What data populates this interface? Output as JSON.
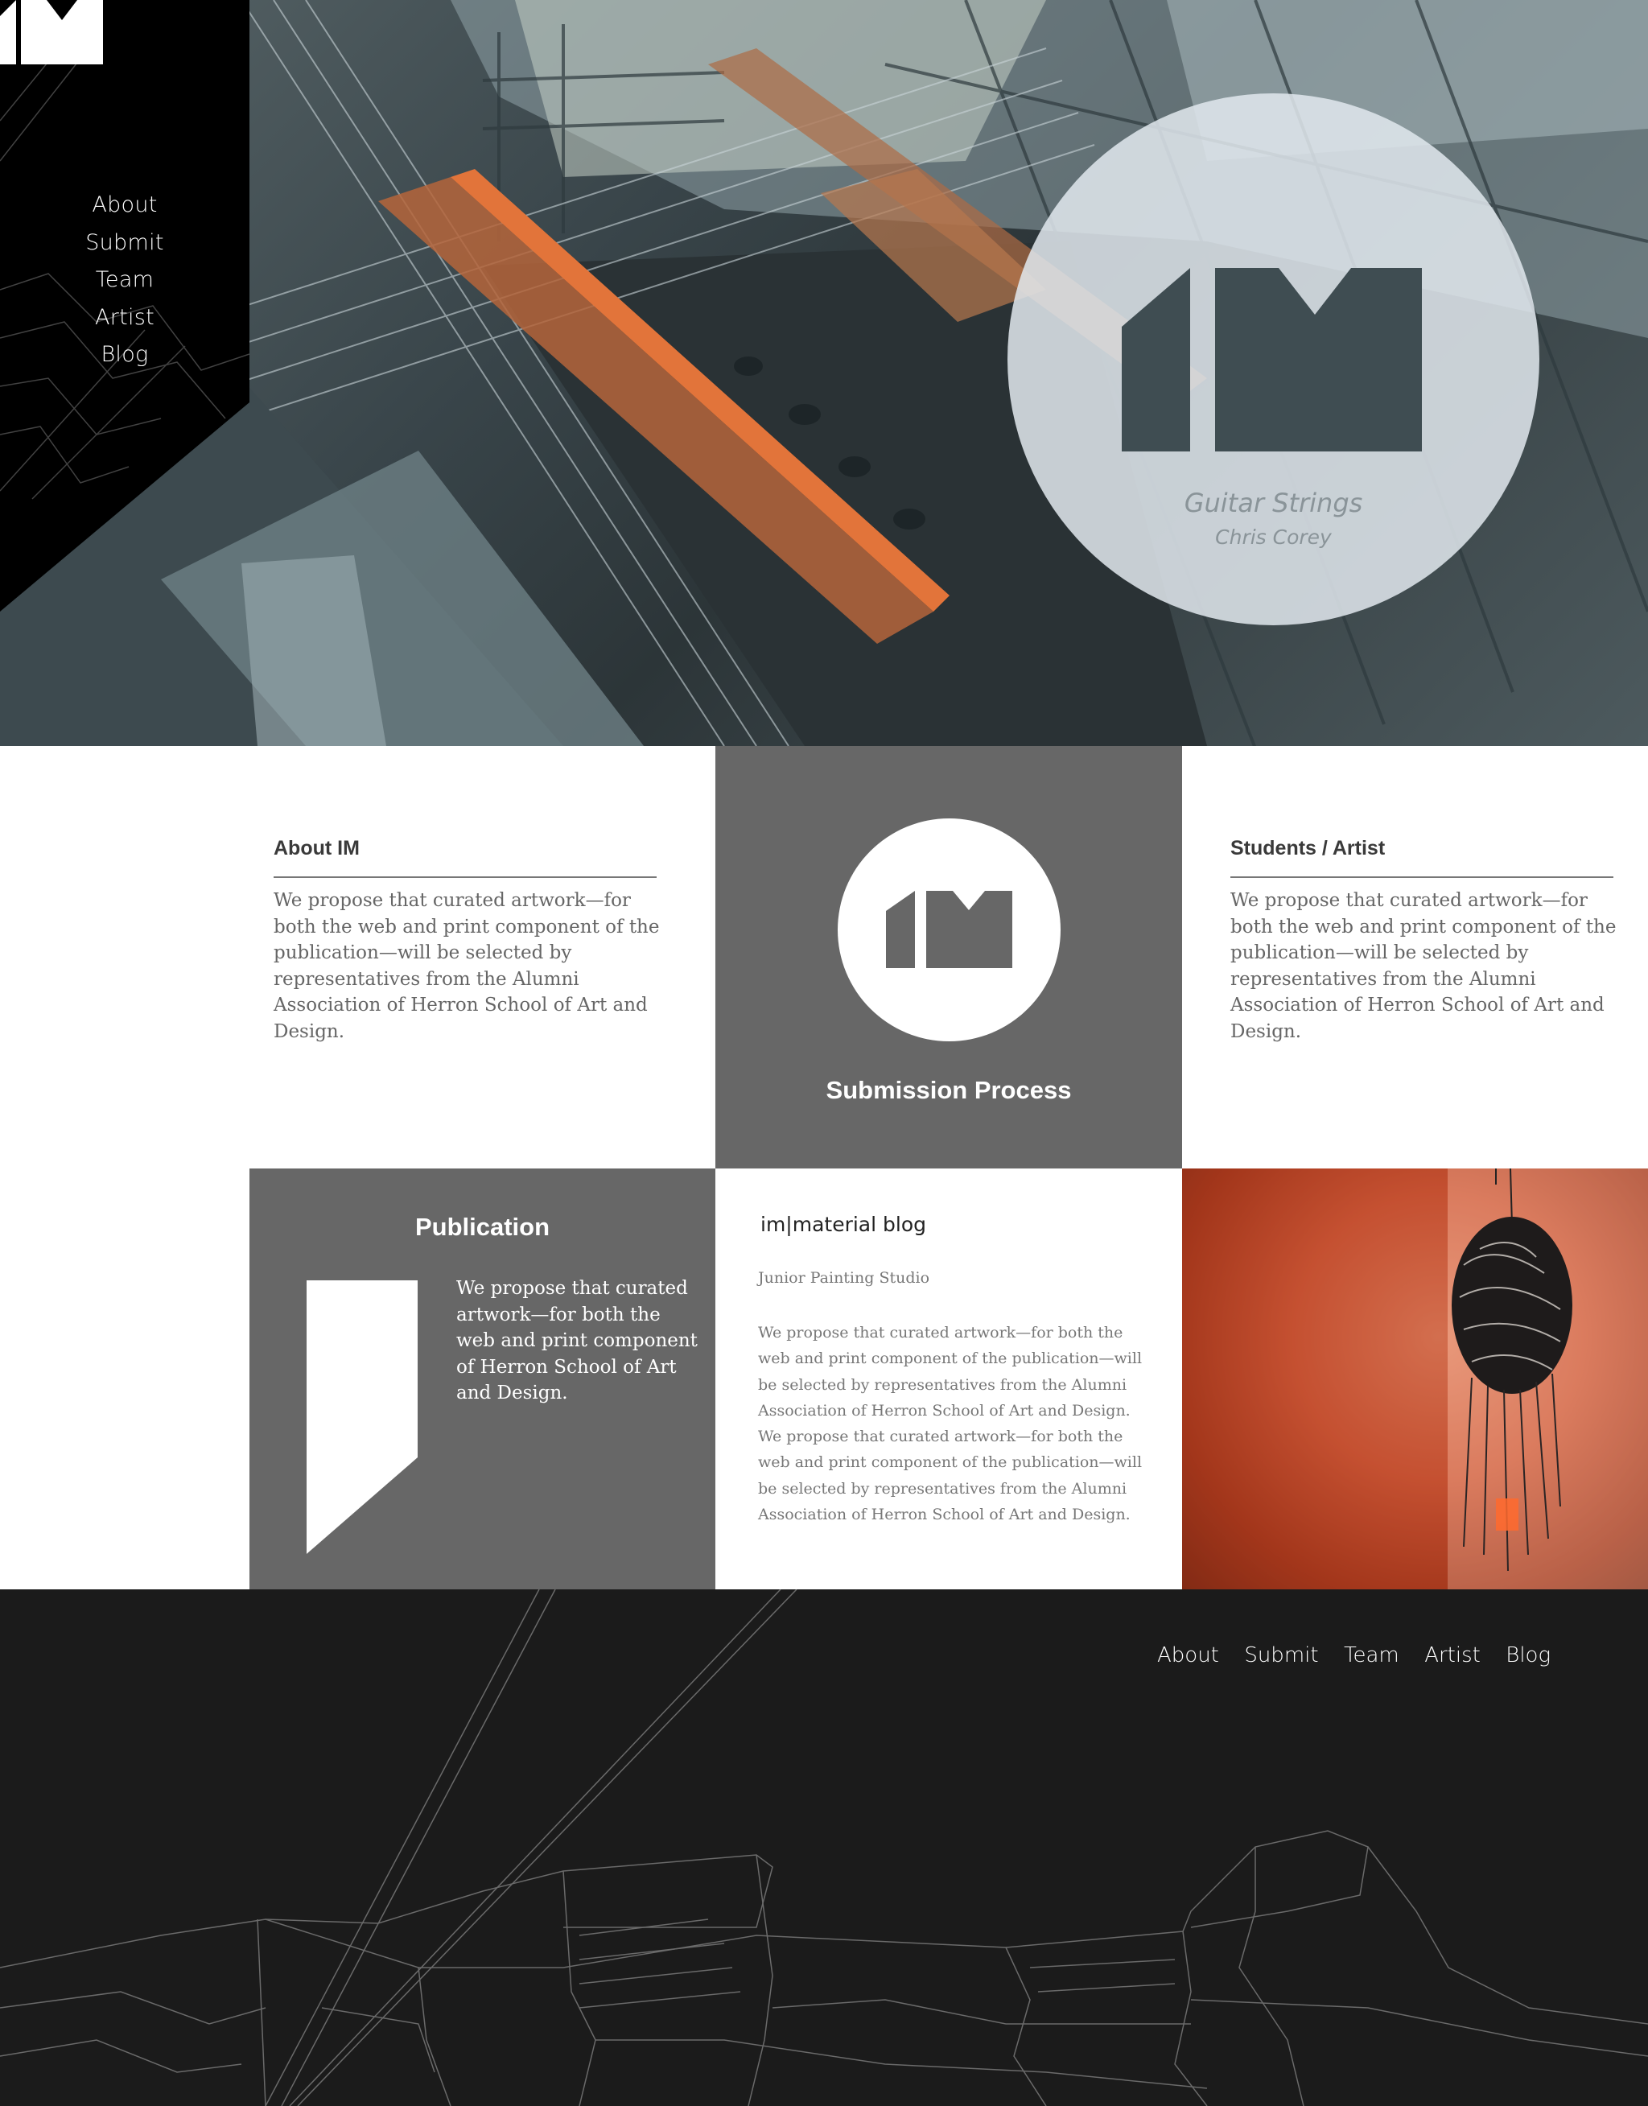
{
  "nav": {
    "items": [
      "About",
      "Submit",
      "Team",
      "Artist",
      "Blog"
    ]
  },
  "hero": {
    "artwork_title": "Guitar Strings",
    "artist": "Chris Corey"
  },
  "about": {
    "heading": "About IM",
    "body": "We propose that curated artwork—for both the web and print component of the publication—will be selected by representatives from the Alumni Association of Herron School of Art and Design."
  },
  "submission": {
    "label": "Submission Process"
  },
  "students": {
    "heading": "Students / Artist",
    "body": "We propose that curated artwork—for both the web and print component of the publication—will be selected by representatives from the Alumni Association of Herron School of Art and Design."
  },
  "publication": {
    "heading": "Publication",
    "body": "We propose that curated artwork—for both the web and print component of Herron School of Art and Design."
  },
  "blog": {
    "title": "im|material blog",
    "subtitle": "Junior Painting Studio",
    "body": "We propose that curated artwork—for both the web and print component of the publication—will be selected by representatives from the Alumni Association of Herron School of Art and Design. We propose that curated artwork—for both the web and print component of the publication—will be selected by representatives from the Alumni Association of Herron School of Art and Design."
  },
  "colors": {
    "panel_gray": "#676767",
    "sidebar_black": "#000000",
    "footer_black": "#1b1b1b",
    "accent_orange": "#d65a2c"
  },
  "icons": [
    "im-logo-icon",
    "publication-bookmark-icon"
  ]
}
